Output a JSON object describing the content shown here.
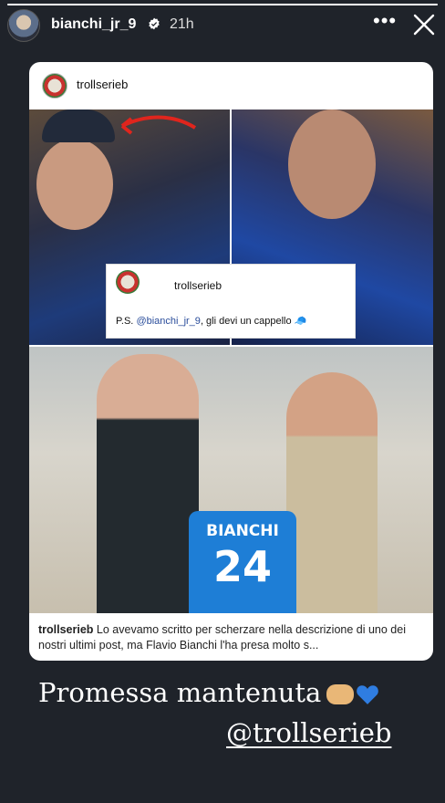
{
  "story": {
    "progress_fraction": 1.0,
    "username": "bianchi_jr_9",
    "time": "21h",
    "more_icon": "more-icon",
    "close_icon": "close-icon"
  },
  "shared_post": {
    "username": "trollserieb",
    "overlay_comment": {
      "username": "trollserieb",
      "text_prefix": "P.S. ",
      "mention": "@bianchi_jr_9",
      "text_suffix": ", gli devi un cappello 🧢"
    },
    "jersey": {
      "name": "BIANCHI",
      "number": "24"
    },
    "caption": {
      "username": "trollserieb",
      "text": "Lo avevamo scritto per scherzare nella descrizione di uno dei nostri ultimi post, ma Flavio Bianchi l'ha presa molto s..."
    }
  },
  "story_text": {
    "line1": "Promessa mantenuta",
    "line2": "@trollserieb"
  },
  "colors": {
    "background": "#1f232a",
    "heart": "#2f7de1"
  }
}
